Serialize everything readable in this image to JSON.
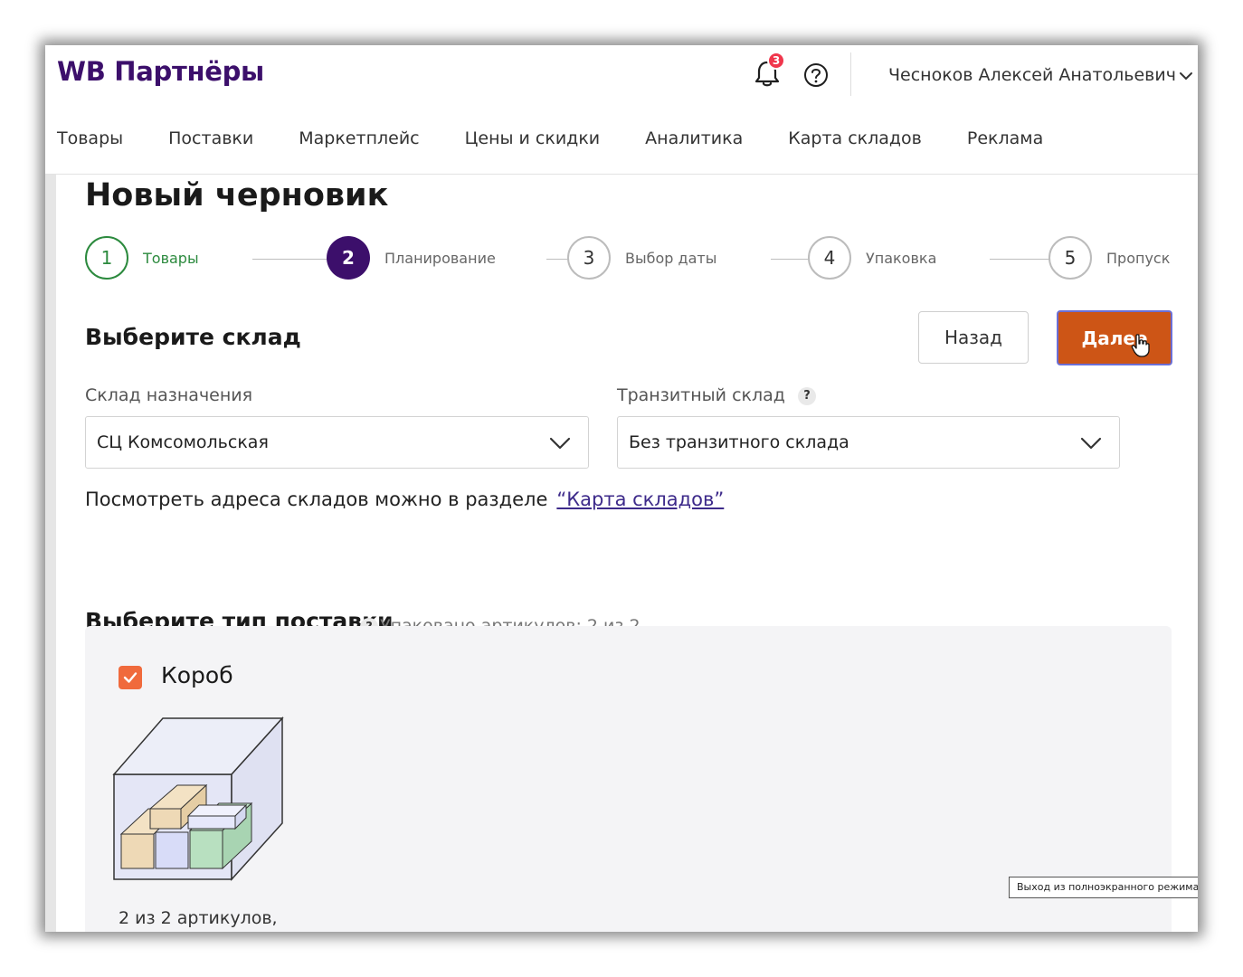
{
  "header": {
    "logo": "WB Партнёры",
    "notifications_count": "3",
    "user_name": "Чесноков Алексей Анатольевич"
  },
  "nav": {
    "items": [
      "Товары",
      "Поставки",
      "Маркетплейс",
      "Цены и скидки",
      "Аналитика",
      "Карта складов",
      "Реклама"
    ]
  },
  "page": {
    "title": "Новый черновик"
  },
  "stepper": {
    "steps": [
      {
        "number": "1",
        "label": "Товары",
        "state": "done"
      },
      {
        "number": "2",
        "label": "Планирование",
        "state": "active"
      },
      {
        "number": "3",
        "label": "Выбор даты",
        "state": "pending"
      },
      {
        "number": "4",
        "label": "Упаковка",
        "state": "pending"
      },
      {
        "number": "5",
        "label": "Пропуск",
        "state": "pending"
      }
    ]
  },
  "warehouse": {
    "section_title": "Выберите склад",
    "back_label": "Назад",
    "next_label": "Далее",
    "destination_label": "Склад назначения",
    "destination_value": "СЦ Комсомольская",
    "transit_label": "Транзитный склад",
    "transit_help": "?",
    "transit_value": "Без транзитного склада",
    "info_text": "Посмотреть адреса складов можно в разделе",
    "info_link": "“Карта складов”"
  },
  "supply_type": {
    "section_title": "Выберите тип поставки",
    "help": "?",
    "packed_text": "Упаковано артикулов: 2 из 2",
    "option_label": "Короб",
    "option_checked": true,
    "option_count": "2 из 2 артикулов,"
  },
  "tooltip": {
    "text": "Выход из полноэкранного режима (f)"
  },
  "colors": {
    "brand": "#3c0f6b",
    "primary_button": "#cd5516",
    "step_done": "#2c8a3e",
    "checkbox": "#f06a3c",
    "badge": "#f0364c",
    "link": "#3d2a8a"
  }
}
